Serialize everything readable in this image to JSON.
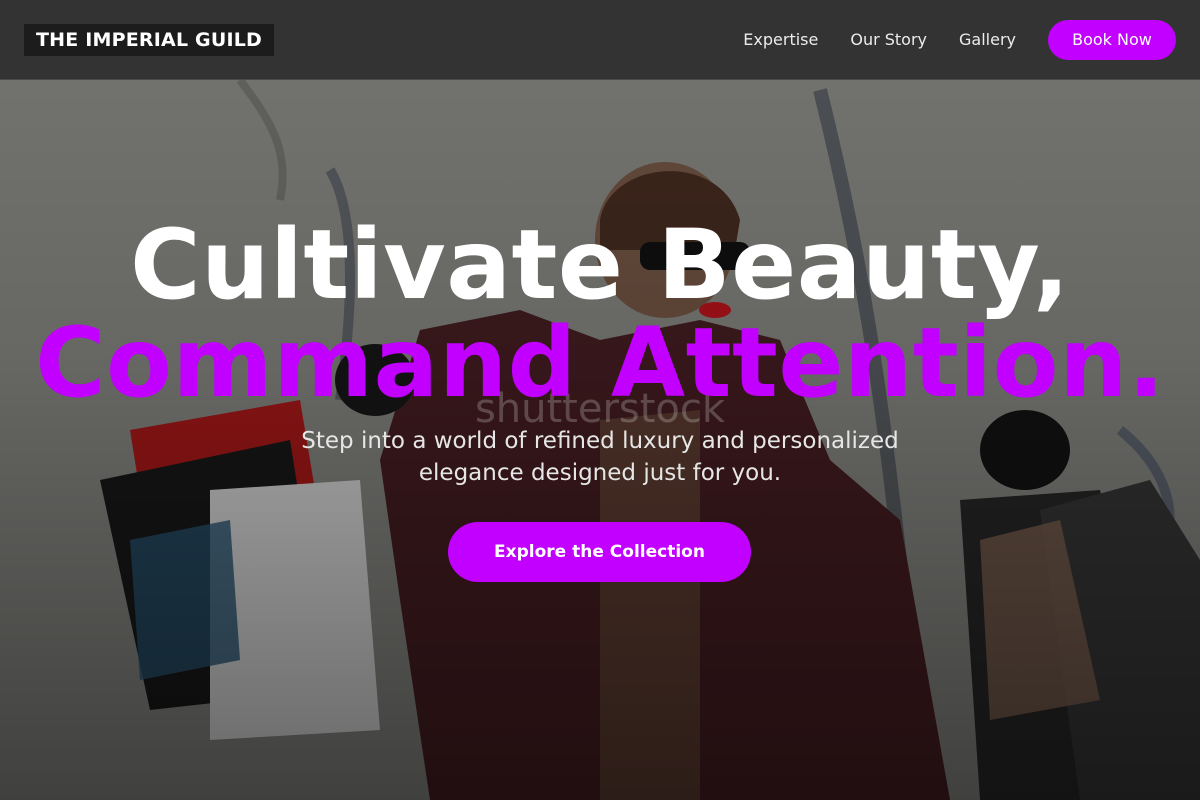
{
  "brand": {
    "name": "THE IMPERIAL GUILD"
  },
  "nav": {
    "links": [
      "Expertise",
      "Our Story",
      "Gallery"
    ],
    "cta_label": "Book Now"
  },
  "hero": {
    "headline_line1": "Cultivate Beauty,",
    "headline_line2": "Command Attention.",
    "subtitle": "Step into a world of refined luxury and personalized elegance designed just for you.",
    "button_label": "Explore the Collection",
    "watermark": "shutterstock"
  },
  "colors": {
    "accent": "#c100ff",
    "navbar": "#333333",
    "brand_bg": "#1c1c1c"
  }
}
